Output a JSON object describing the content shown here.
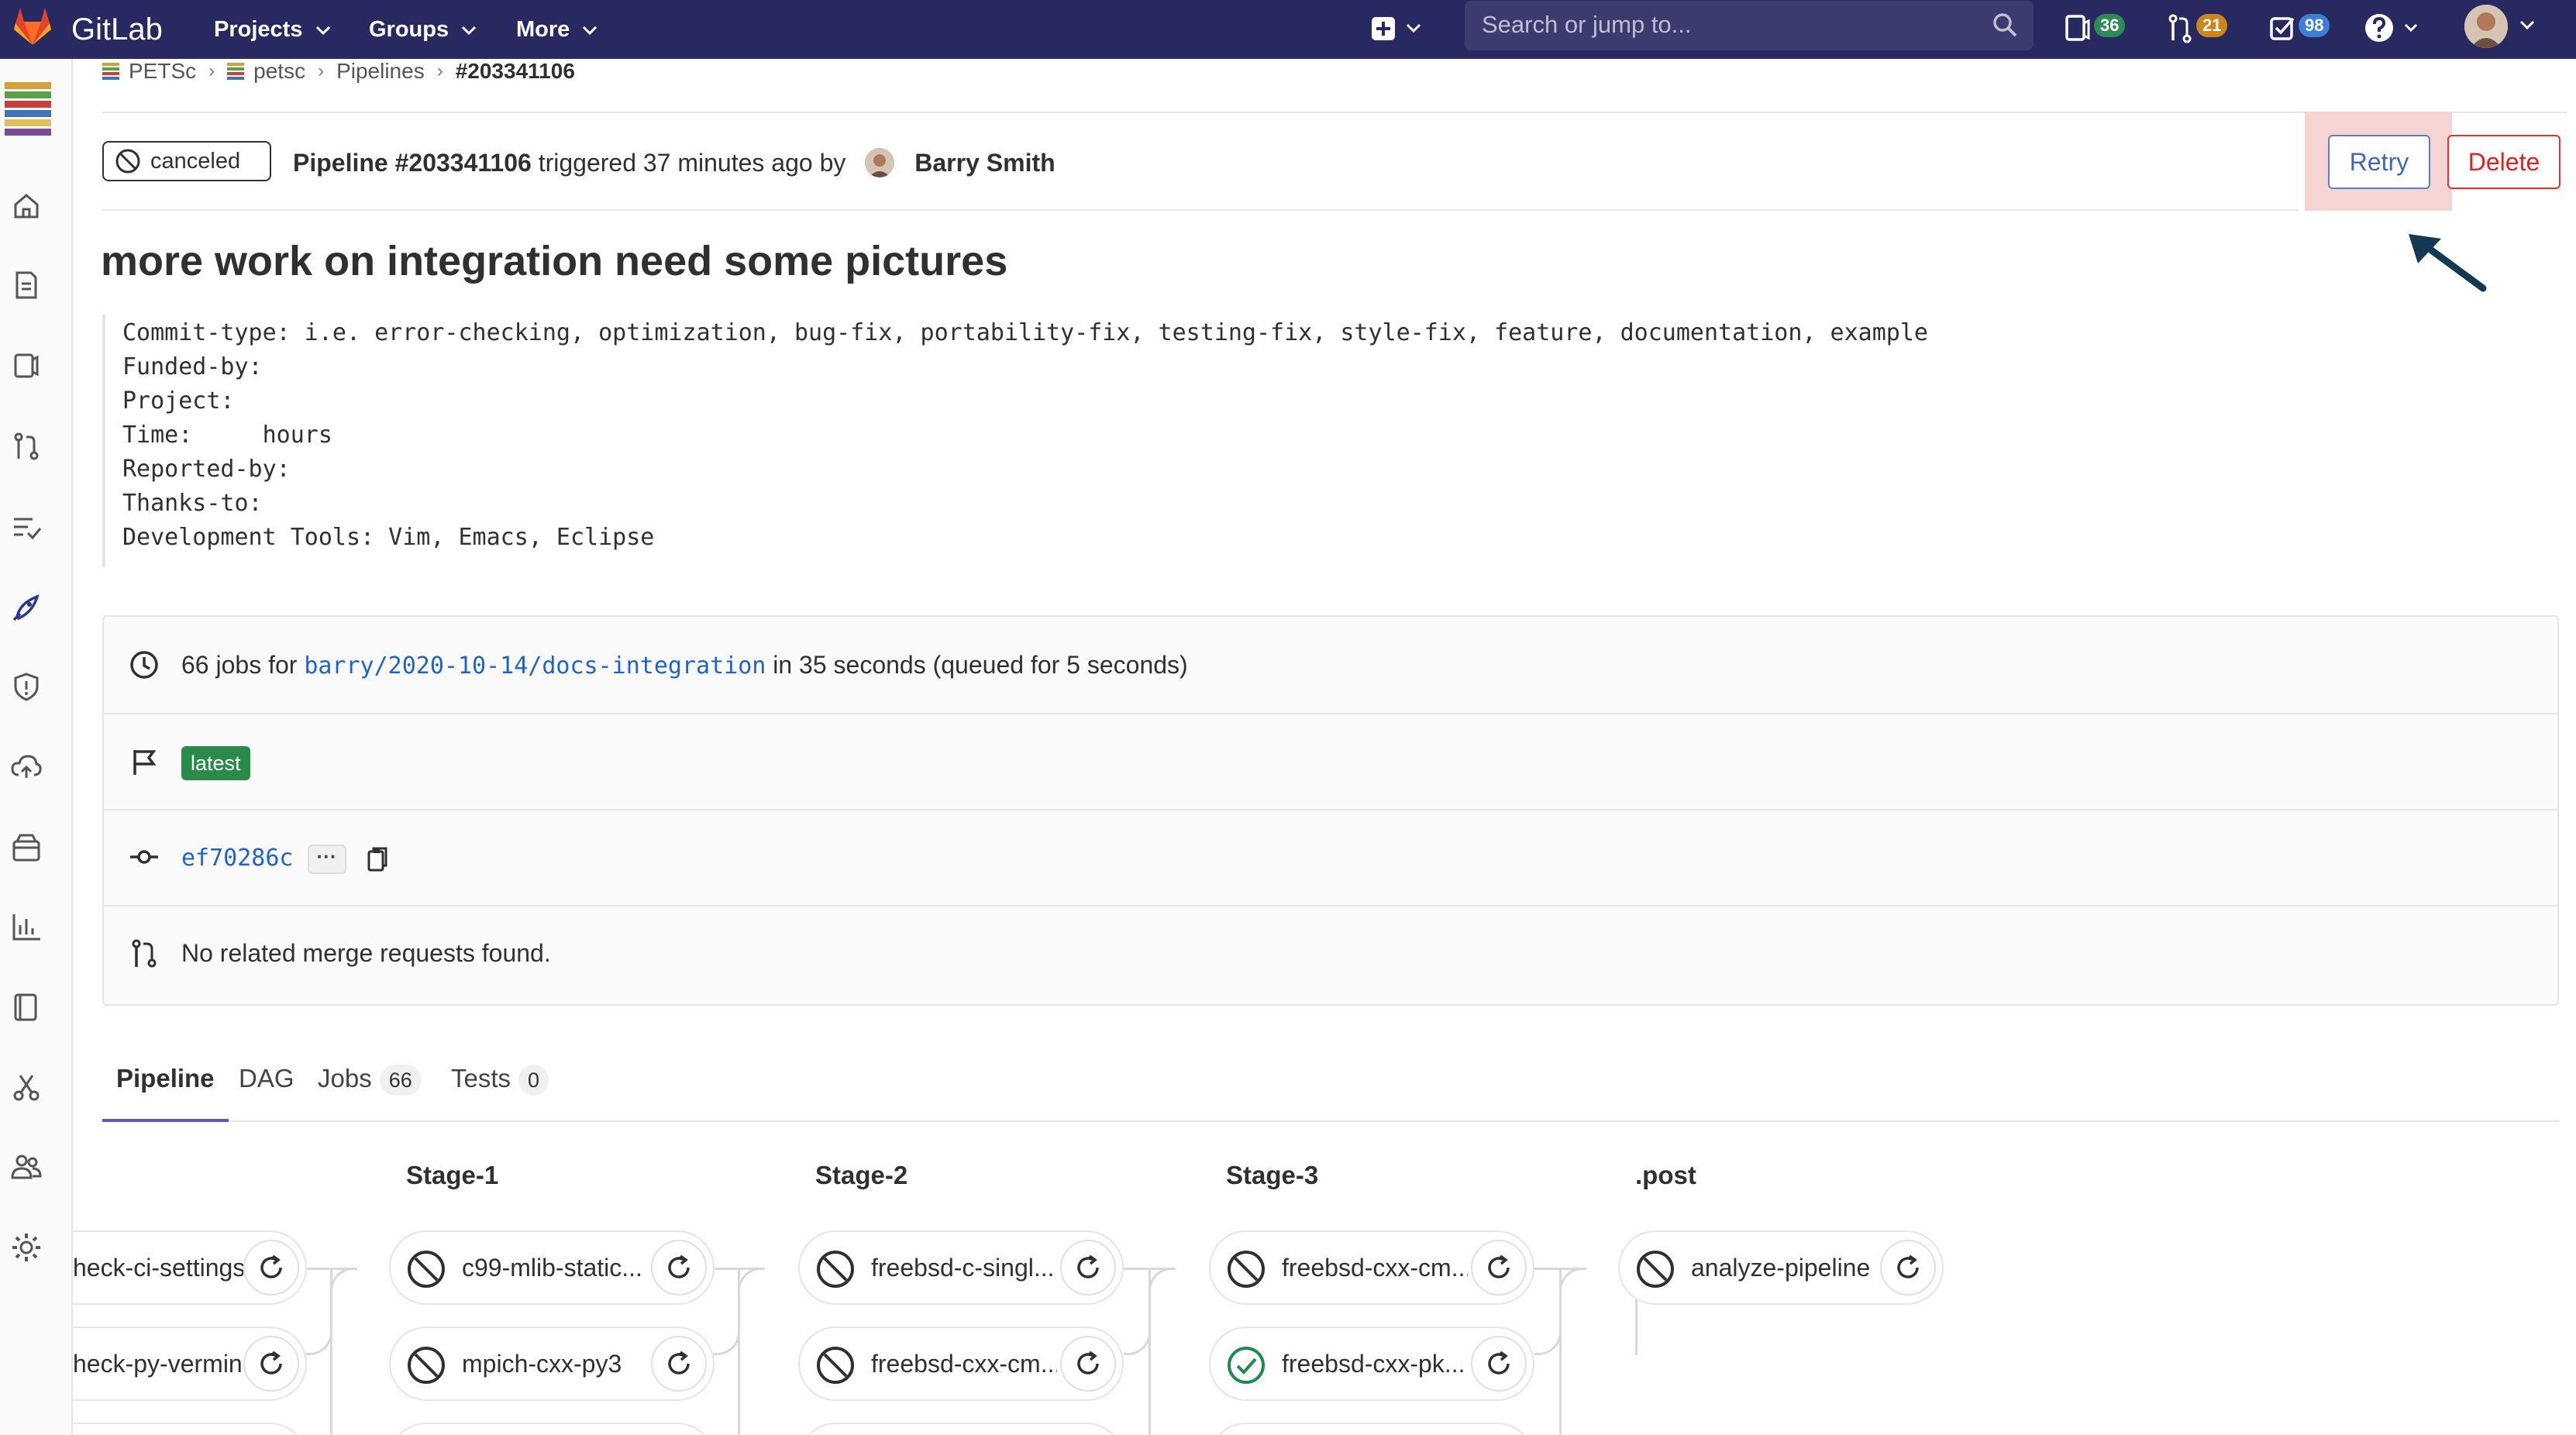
{
  "nav": {
    "brand": "GitLab",
    "items": [
      "Projects",
      "Groups",
      "More"
    ],
    "search_placeholder": "Search or jump to...",
    "counters": {
      "issues": "36",
      "merge_requests": "21",
      "todos": "98"
    },
    "colors": {
      "bar": "#292961",
      "issues_badge": "#2e8b57",
      "mr_badge": "#c9861a",
      "todos_badge": "#3d7fd6"
    }
  },
  "sidebar": {
    "icons": [
      "home-icon",
      "repository-icon",
      "issues-icon",
      "merge-requests-icon",
      "requirements-icon",
      "ci-cd-icon",
      "security-icon",
      "operations-icon",
      "packages-icon",
      "analytics-icon",
      "wiki-icon",
      "snippets-icon",
      "members-icon",
      "settings-icon"
    ],
    "active": "ci-cd-icon"
  },
  "breadcrumb": [
    "PETSc",
    "petsc",
    "Pipelines",
    "#203341106"
  ],
  "pipeline": {
    "status": "canceled",
    "title_bold": "Pipeline #203341106",
    "title_rest": " triggered 37 minutes ago by ",
    "author": "Barry Smith",
    "retry_label": "Retry",
    "delete_label": "Delete"
  },
  "commit": {
    "title": "more work on integration need some pictures",
    "lines": [
      "Commit-type: i.e. error-checking, optimization, bug-fix, portability-fix, testing-fix, style-fix, feature, documentation, example",
      "Funded-by:",
      "Project:",
      "Time:     hours",
      "Reported-by:",
      "Thanks-to:",
      "Development Tools: Vim, Emacs, Eclipse"
    ]
  },
  "info": {
    "jobs_prefix": "66 jobs for ",
    "branch": "barry/2020-10-14/docs-integration",
    "jobs_suffix": " in 35 seconds (queued for 5 seconds)",
    "badge": "latest",
    "sha": "ef70286c",
    "ellipsis": "···",
    "merge_requests": "No related merge requests found."
  },
  "tabs": [
    {
      "label": "Pipeline",
      "count": ""
    },
    {
      "label": "DAG",
      "count": ""
    },
    {
      "label": "Jobs",
      "count": "66"
    },
    {
      "label": "Tests",
      "count": "0"
    }
  ],
  "graph": {
    "stages": [
      {
        "title": "",
        "jobs": [
          "heck-ci-settings",
          "heck-py-vermin"
        ]
      },
      {
        "title": "Stage-1",
        "jobs": [
          "c99-mlib-static...",
          "mpich-cxx-py3"
        ]
      },
      {
        "title": "Stage-2",
        "jobs": [
          "freebsd-c-singl...",
          "freebsd-cxx-cm..."
        ]
      },
      {
        "title": "Stage-3",
        "jobs": [
          "freebsd-cxx-cm...",
          "freebsd-cxx-pk..."
        ]
      },
      {
        "title": ".post",
        "jobs": [
          "analyze-pipeline"
        ]
      }
    ],
    "job_status": {
      "freebsd-cxx-pk...": "success"
    }
  }
}
